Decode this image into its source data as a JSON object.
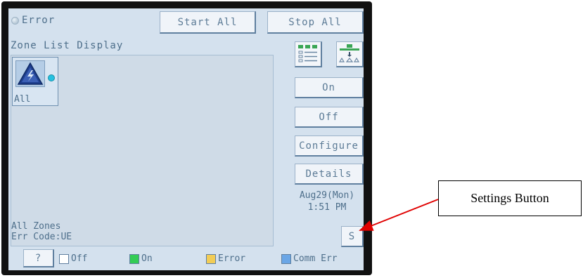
{
  "header": {
    "status_label": "Error",
    "start_all_label": "Start All",
    "stop_all_label": "Stop All"
  },
  "zone_list": {
    "title": "Zone List Display",
    "tiles": [
      {
        "label": "All",
        "icon": "warning-triangle-icon",
        "indicator_color": "#26c1e0"
      }
    ],
    "status_line_1": "All Zones",
    "status_line_2": "Err Code:UE"
  },
  "side_panel": {
    "view_icons": [
      "grid-view-icon",
      "tree-view-icon"
    ],
    "on_label": "On",
    "off_label": "Off",
    "configure_label": "Configure",
    "details_label": "Details",
    "date": "Aug29(Mon)",
    "time": "1:51 PM",
    "settings_label": "S"
  },
  "footer": {
    "help_label": "?",
    "legend": [
      {
        "label": "Off",
        "color": "#ffffff"
      },
      {
        "label": "On",
        "color": "#33cc55"
      },
      {
        "label": "Error",
        "color": "#f2cc55"
      },
      {
        "label": "Comm Err",
        "color": "#6aa6e6"
      }
    ]
  },
  "annotation": {
    "callout_label": "Settings Button",
    "arrow_color": "#e00000"
  }
}
